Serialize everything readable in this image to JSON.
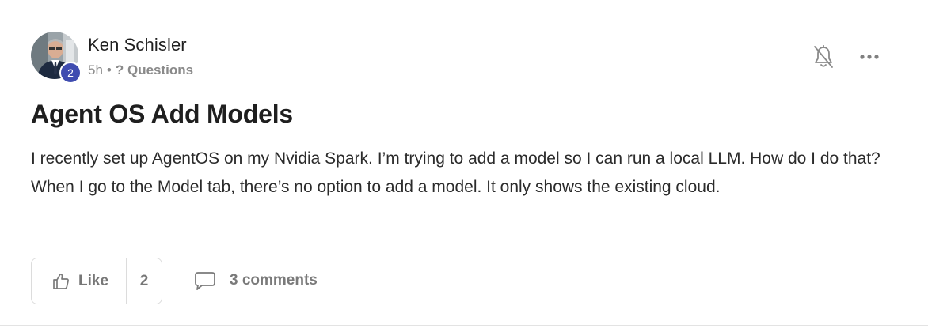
{
  "author": {
    "name": "Ken Schisler",
    "level": "2",
    "avatar_icon": "user-photo-avatar"
  },
  "meta": {
    "time": "5h",
    "separator": "•",
    "category": "? Questions"
  },
  "actions": {
    "follow_icon": "bell-slash-icon",
    "more_icon": "more-horizontal-icon"
  },
  "post": {
    "title": "Agent OS Add Models",
    "body": "I recently set up AgentOS on my Nvidia Spark. I’m trying to add a model so I can run a local LLM. How do I do that? When I go to the Model tab, there’s no option to add a model. It only shows the existing cloud."
  },
  "footer": {
    "like_label": "Like",
    "like_count": "2",
    "comments_label": "3 comments"
  },
  "colors": {
    "badge": "#3f4cb0",
    "muted_text": "#8a8a8a",
    "border": "#dcdcdc"
  }
}
